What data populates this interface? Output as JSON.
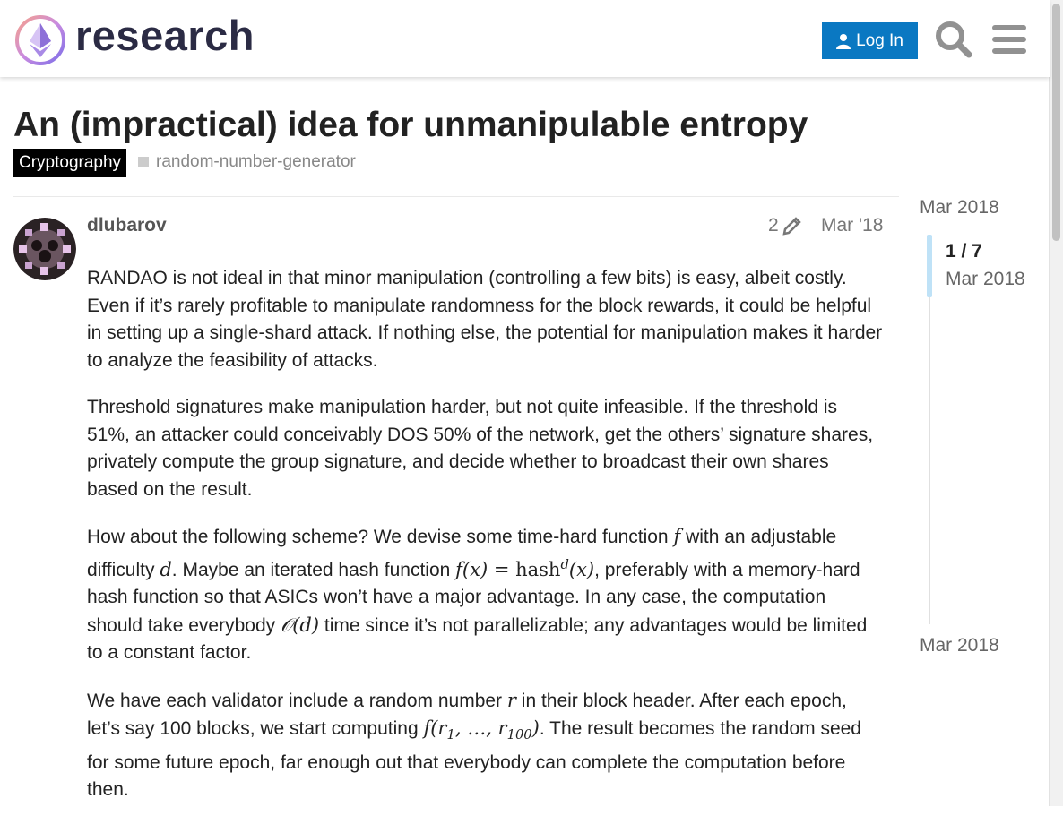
{
  "header": {
    "site_name": "research",
    "login_label": "Log In",
    "icons": [
      "search-icon",
      "hamburger-menu-icon",
      "user-icon"
    ],
    "accent_color": "#0a78c2"
  },
  "topic": {
    "title": "An (impractical) idea for unmanipulable entropy",
    "category": "Cryptography",
    "tag": "random-number-generator"
  },
  "post": {
    "author": "dlubarov",
    "edit_count": "2",
    "date": "Mar '18",
    "p1": "RANDAO is not ideal in that minor manipulation (controlling a few bits) is easy, albeit costly. Even if it’s rarely profitable to manipulate randomness for the block rewards, it could be helpful in setting up a single-shard attack. If nothing else, the potential for manipulation makes it harder to analyze the feasibility of attacks.",
    "p2": "Threshold signatures make manipulation harder, but not quite infeasible. If the threshold is 51%, an attacker could conceivably DOS 50% of the network, get the others’ signature shares, privately compute the group signature, and decide whether to broadcast their own shares based on the result.",
    "p3": {
      "t1": "How about the following scheme? We devise some time-hard function ",
      "m1": "f",
      "t2": " with an adjustable difficulty ",
      "m2": "d",
      "t3": ". Maybe an iterated hash function ",
      "m3a": "f(x) = ",
      "m3b": "hash",
      "m3c": "d",
      "m3d": "(x)",
      "t4": ", preferably with a memory-hard hash function so that ASICs won’t have a major advantage. In any case, the computation should take everybody ",
      "m4": "𝒪(d)",
      "t5": " time since it’s not parallelizable; any advantages would be limited to a constant factor."
    },
    "p4": {
      "t1": "We have each validator include a random number ",
      "m1": "r",
      "t2": " in their block header. After each epoch, let’s say 100 blocks, we start computing ",
      "m2a": "f(r",
      "m2b": "1",
      "m2c": ", …, r",
      "m2d": "100",
      "m2e": ")",
      "t3": ". The result becomes the random seed for some future epoch, far enough out that everybody can complete the computation before then."
    }
  },
  "timeline": {
    "start_date": "Mar 2018",
    "position": "1 / 7",
    "current_date": "Mar 2018",
    "end_date": "Mar 2018"
  }
}
